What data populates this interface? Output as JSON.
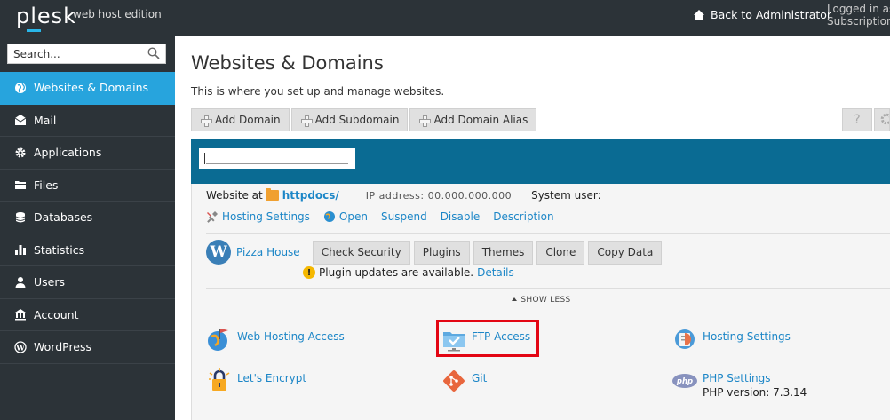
{
  "topbar": {
    "logo": "plesk",
    "edition": "web host edition",
    "back_label": "Back to Administrator",
    "login_line1": "Logged in as",
    "login_line2": "Subscription"
  },
  "sidebar": {
    "search_placeholder": "Search...",
    "items": [
      {
        "label": "Websites & Domains",
        "icon": "globe-icon",
        "active": true
      },
      {
        "label": "Mail",
        "icon": "mail-icon"
      },
      {
        "label": "Applications",
        "icon": "gear-icon"
      },
      {
        "label": "Files",
        "icon": "files-icon"
      },
      {
        "label": "Databases",
        "icon": "database-icon"
      },
      {
        "label": "Statistics",
        "icon": "bar-chart-icon"
      },
      {
        "label": "Users",
        "icon": "user-icon"
      },
      {
        "label": "Account",
        "icon": "account-icon"
      },
      {
        "label": "WordPress",
        "icon": "wordpress-icon"
      }
    ]
  },
  "main": {
    "title": "Websites & Domains",
    "description": "This is where you set up and manage websites.",
    "toolbar": [
      "Add Domain",
      "Add Subdomain",
      "Add Domain Alias"
    ],
    "help_label": "?",
    "website": {
      "prefix": "Website at",
      "folder": "httpdocs/",
      "masked_ip": "IP address: 00.000.000.000",
      "system_user_label": "System user:"
    },
    "actions": [
      "Hosting Settings",
      "Open",
      "Suspend",
      "Disable",
      "Description"
    ],
    "wordpress": {
      "site": "Pizza House",
      "buttons": [
        "Check Security",
        "Plugins",
        "Themes",
        "Clone",
        "Copy Data"
      ],
      "notice": "Plugin updates are available.",
      "details": "Details"
    },
    "show_less": "SHOW LESS",
    "tools": {
      "web_hosting_access": "Web Hosting Access",
      "ftp_access": "FTP Access",
      "hosting_settings": "Hosting Settings",
      "lets_encrypt": "Let's Encrypt",
      "git": "Git",
      "php_settings": "PHP Settings",
      "php_version": "PHP version: 7.3.14"
    }
  },
  "colors": {
    "topbar": "#2c3338",
    "accent": "#27a4dd",
    "panel_header": "#0a6b93",
    "link": "#1c86c7",
    "highlight": "#e30613"
  }
}
